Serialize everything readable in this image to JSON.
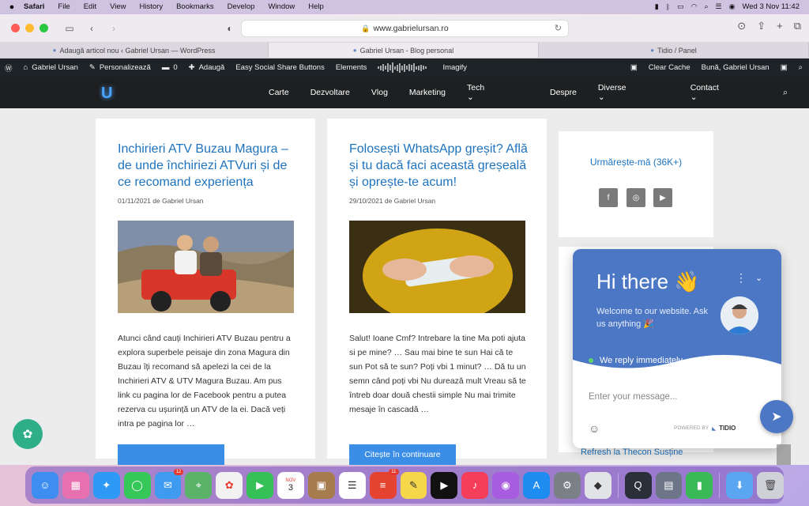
{
  "menubar": {
    "app_name": "Safari",
    "items": [
      "File",
      "Edit",
      "View",
      "History",
      "Bookmarks",
      "Develop",
      "Window",
      "Help"
    ],
    "datetime": "Wed 3 Nov  11:42"
  },
  "browser": {
    "url": "www.gabrielursan.ro",
    "tabs": [
      {
        "label": "Adaugă articol nou ‹ Gabriel Ursan — WordPress"
      },
      {
        "label": "Gabriel Ursan - Blog personal"
      },
      {
        "label": "Tidio / Panel"
      }
    ]
  },
  "wp_admin_bar": {
    "site_name": "Gabriel Ursan",
    "customize": "Personalizează",
    "comments_count": "0",
    "add_new": "Adaugă",
    "plugin1": "Easy Social Share Buttons",
    "plugin2": "Elements",
    "plugin3": "Imagify",
    "clear_cache": "Clear Cache",
    "greeting": "Bună, Gabriel Ursan"
  },
  "site_nav": {
    "logo": "U",
    "items": [
      "Carte",
      "Dezvoltare",
      "Vlog",
      "Marketing",
      "Tech",
      "Despre",
      "Diverse",
      "Contact"
    ]
  },
  "posts": [
    {
      "title": "Inchirieri ATV Buzau Magura – de unde închiriezi ATVuri și de ce recomand experiența",
      "meta": "01/11/2021 de Gabriel Ursan",
      "excerpt": "Atunci când cauți Inchirieri ATV Buzau pentru a explora superbele peisaje din zona Magura din Buzau îți recomand să apelezi la cei de la Inchirieri ATV & UTV Magura Buzau. Am pus link cu pagina lor de Facebook pentru a putea rezerva cu ușurință un ATV de la ei. Dacă veți intra pe pagina lor …"
    },
    {
      "title": "Folosești WhatsApp greșit? Află și tu dacă faci această greșeală și oprește-te acum!",
      "meta": "29/10/2021 de Gabriel Ursan",
      "excerpt": "Salut! Ioane Cmf? Intrebare la tine Ma poti ajuta si pe mine? … Sau mai bine te sun Hai că te sun Pot să te sun? Poți vbi 1 minut? … Dă tu un semn când poți vbi Nu durează mult Vreau să te întreb doar două chestii simple Nu mai trimite mesaje în cascadă …",
      "button": "Citește în continuare"
    }
  ],
  "sidebar": {
    "follow_title": "Urmărește-mă (36K+)",
    "bottom_link": "Refresh la Thecon Susține"
  },
  "chat": {
    "greeting": "Hi there 👋",
    "welcome": "Welcome to our website. Ask us anything 🎉",
    "reply_status": "We reply immediately",
    "placeholder": "Enter your message...",
    "powered_by": "POWERED BY",
    "brand": "TIDIO"
  },
  "dock": {
    "mail_badge": "12",
    "todoist_badge": "11",
    "calendar_month": "NOV",
    "calendar_day": "3"
  },
  "colors": {
    "link_blue": "#1e73be",
    "button_blue": "#3a8ee6",
    "chat_blue": "#4b77c5",
    "admin_bar": "#1d2327"
  }
}
